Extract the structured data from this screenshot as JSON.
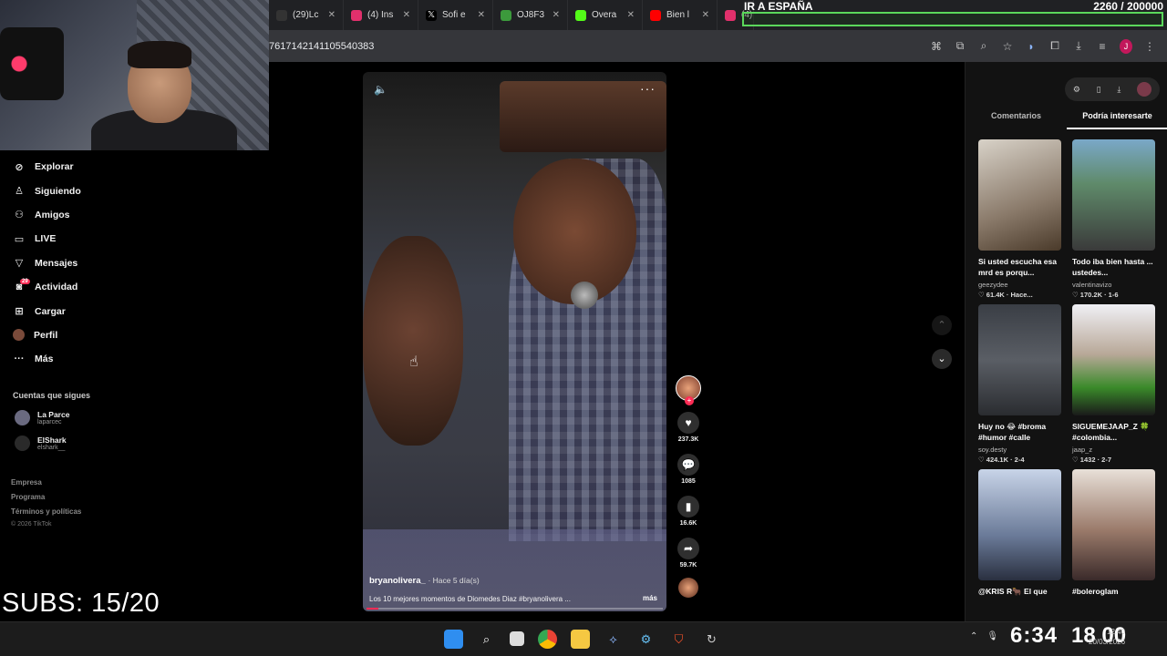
{
  "browser": {
    "tabs": [
      {
        "label": "(29)Lc",
        "color": "#202124"
      },
      {
        "label": "(4) Ins",
        "color": "#e1306c"
      },
      {
        "label": "Sofi e",
        "color": "#000000"
      },
      {
        "label": "OJ8F3",
        "color": "#3c9a3c"
      },
      {
        "label": "Overa",
        "color": "#53fc18"
      },
      {
        "label": "Bien l",
        "color": "#ff0000"
      },
      {
        "label": "(4)",
        "color": "#e1306c"
      }
    ],
    "url": "7617142141105540383"
  },
  "overlay": {
    "title": "IR A ESPAÑA",
    "counter": "2260 / 200000"
  },
  "sidebar": {
    "items": [
      {
        "label": "Explorar",
        "icon": "compass-icon"
      },
      {
        "label": "Siguiendo",
        "icon": "user-follow-icon"
      },
      {
        "label": "Amigos",
        "icon": "friends-icon"
      },
      {
        "label": "LIVE",
        "icon": "live-icon"
      },
      {
        "label": "Mensajes",
        "icon": "send-icon"
      },
      {
        "label": "Actividad",
        "icon": "activity-icon",
        "badge": "29"
      },
      {
        "label": "Cargar",
        "icon": "upload-icon"
      },
      {
        "label": "Perfil",
        "icon": "profile-icon"
      },
      {
        "label": "Más",
        "icon": "more-icon"
      }
    ],
    "following_title": "Cuentas que sigues",
    "following": [
      {
        "name": "La Parce",
        "handle": "laparcec"
      },
      {
        "name": "ElShark",
        "handle": "elshark__"
      }
    ],
    "footer": [
      "Empresa",
      "Programa",
      "Términos y políticas"
    ],
    "copyright": "© 2026 TikTok"
  },
  "stream_overlay": {
    "subs": "SUBS: 15/20"
  },
  "video": {
    "author": "bryanolivera_",
    "ago": "· Hace 5 día(s)",
    "caption": "Los 10 mejores momentos de Diomedes Diaz #bryanolivera ...",
    "more": "más",
    "progress": 0.04
  },
  "actions": {
    "likes": "237.3K",
    "comments": "1085",
    "saves": "16.6K",
    "shares": "59.7K"
  },
  "right_panel": {
    "tabs": [
      "Comentarios",
      "Podría interesarte"
    ],
    "active_tab": 1,
    "cards": [
      {
        "title": "Si usted escucha esa mrd es porqu...",
        "user": "geezydee",
        "meta": "♡ 61.4K · Hace...",
        "c1": "#c9c2b8",
        "c2": "#6b5a4a"
      },
      {
        "title": "Todo iba bien hasta ... ustedes...",
        "user": "valentinavizo",
        "meta": "♡ 170.2K · 1-6",
        "c1": "#5f8a6a",
        "c2": "#2f3e4a"
      },
      {
        "title": "Huy no 😂 #broma #humor #calle",
        "user": "soy.desty",
        "meta": "♡ 424.1K · 2-4",
        "c1": "#4a4e55",
        "c2": "#1f2228"
      },
      {
        "title": "SIGUEMEJAAP_Z 🍀 #colombia...",
        "user": "jaap_z",
        "meta": "♡ 1432 · 2-7",
        "c1": "#e8e8f0",
        "c2": "#3a8a2a"
      },
      {
        "title": "@KRIS R🐂 El que",
        "user": "",
        "meta": "",
        "c1": "#b8c4d8",
        "c2": "#5a6a88"
      },
      {
        "title": "#boleroglam",
        "user": "",
        "meta": "",
        "c1": "#d8cfc4",
        "c2": "#7a4a3a"
      }
    ]
  },
  "taskbar": {
    "clock": "6:34",
    "clock2": "18 00",
    "time_small": "12:40",
    "date_small": "20/03/2026"
  }
}
